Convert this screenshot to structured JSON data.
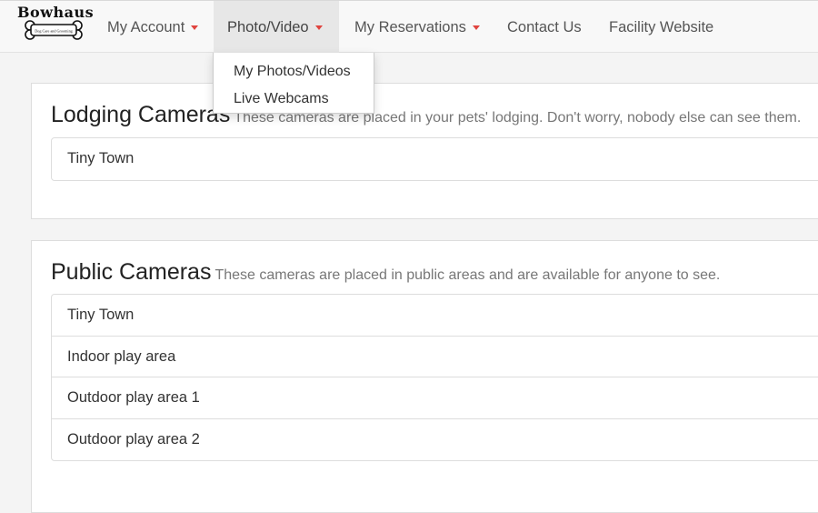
{
  "brand": {
    "name": "Bowhaus",
    "tagline": "Dog Care and Grooming"
  },
  "nav": {
    "items": [
      {
        "label": "My Account",
        "has_caret": true
      },
      {
        "label": "Photo/Video",
        "has_caret": true,
        "active": true
      },
      {
        "label": "My Reservations",
        "has_caret": true
      },
      {
        "label": "Contact Us",
        "has_caret": false
      },
      {
        "label": "Facility Website",
        "has_caret": false
      }
    ]
  },
  "dropdown": {
    "items": [
      {
        "label": "My Photos/Videos"
      },
      {
        "label": "Live Webcams"
      }
    ]
  },
  "lodging": {
    "title": "Lodging Cameras",
    "subtitle": "These cameras are placed in your pets' lodging. Don't worry, nobody else can see them.",
    "cameras": [
      "Tiny Town"
    ]
  },
  "public": {
    "title": "Public Cameras",
    "subtitle": "These cameras are placed in public areas and are available for anyone to see.",
    "cameras": [
      "Tiny Town",
      "Indoor play area",
      "Outdoor play area 1",
      "Outdoor play area 2"
    ]
  },
  "colors": {
    "caret": "#e0443f",
    "active_nav_bg": "#e7e7e7",
    "page_bg": "#f4f4f4"
  }
}
